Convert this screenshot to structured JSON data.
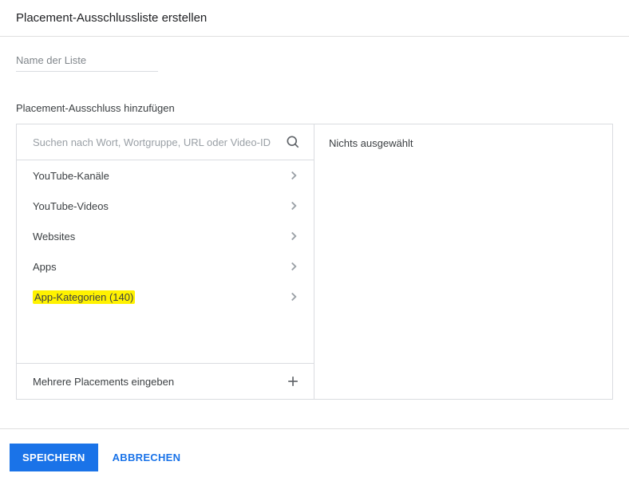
{
  "header": {
    "title": "Placement-Ausschlussliste erstellen"
  },
  "listName": {
    "placeholder": "Name der Liste"
  },
  "section": {
    "label": "Placement-Ausschluss hinzufügen"
  },
  "search": {
    "placeholder": "Suchen nach Wort, Wortgruppe, URL oder Video-ID"
  },
  "categories": [
    {
      "label": "YouTube-Kanäle",
      "highlighted": false
    },
    {
      "label": "YouTube-Videos",
      "highlighted": false
    },
    {
      "label": "Websites",
      "highlighted": false
    },
    {
      "label": "Apps",
      "highlighted": false
    },
    {
      "label": "App-Kategorien (140)",
      "highlighted": true
    }
  ],
  "multi": {
    "label": "Mehrere Placements eingeben"
  },
  "rightPanel": {
    "text": "Nichts ausgewählt"
  },
  "footer": {
    "save": "SPEICHERN",
    "cancel": "ABBRECHEN"
  }
}
